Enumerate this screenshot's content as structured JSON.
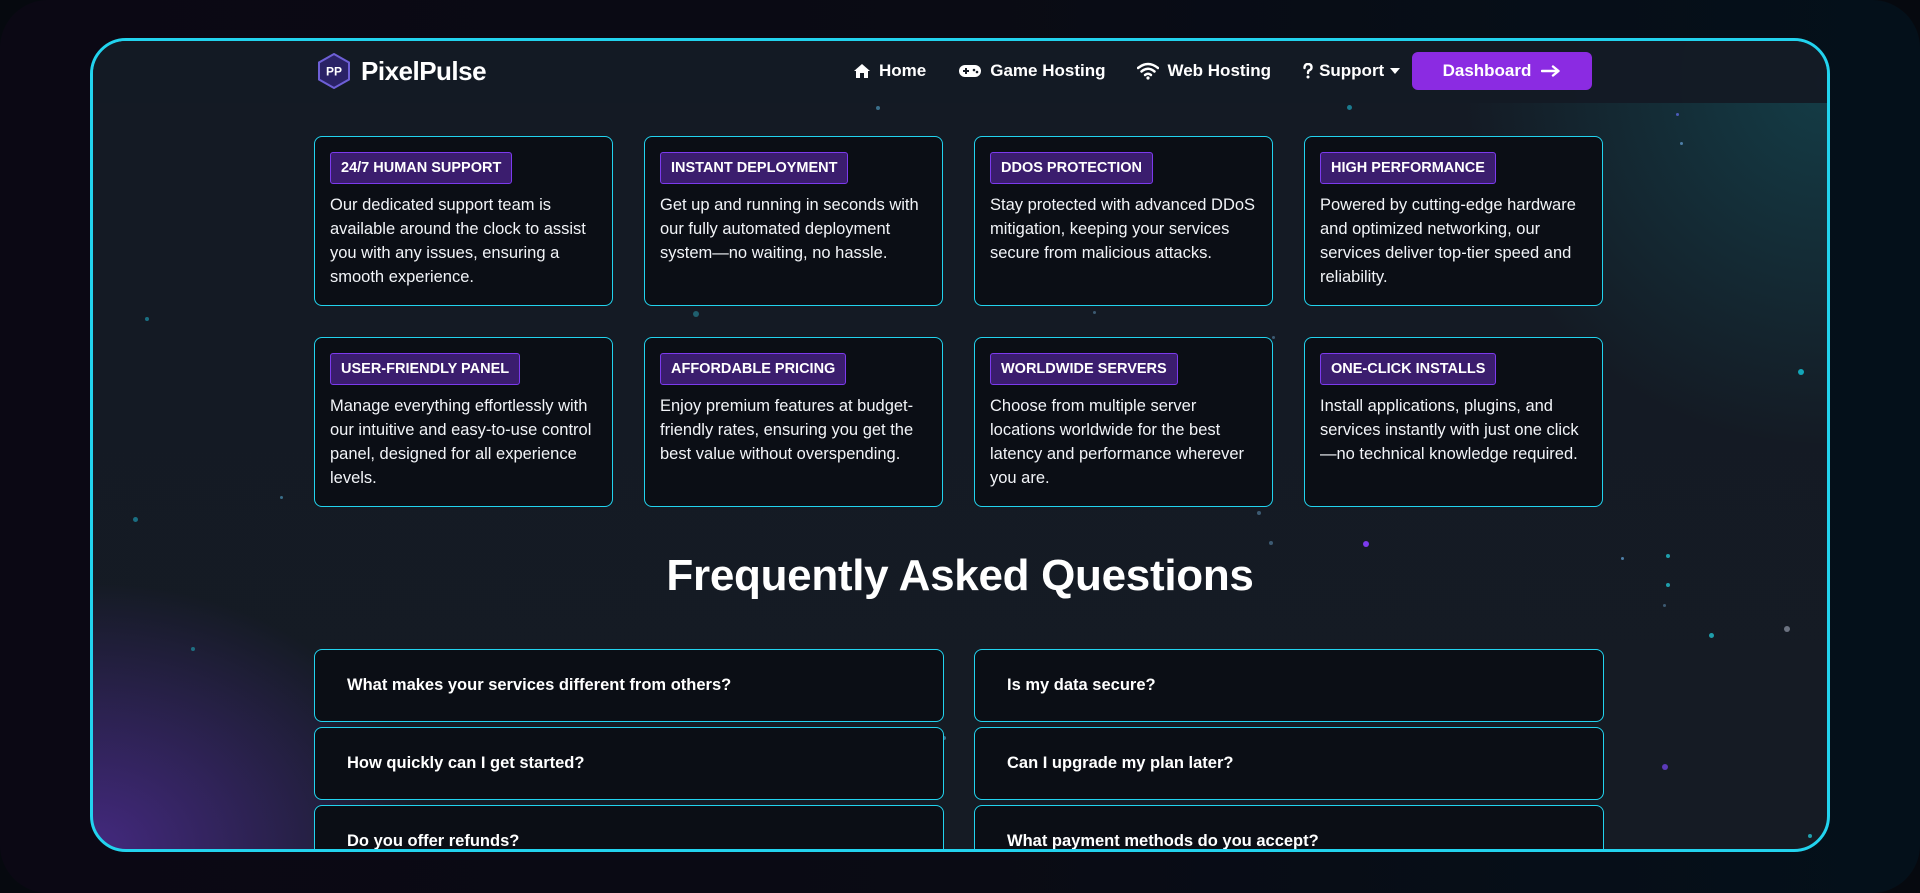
{
  "brand": {
    "logo_initials": "PP",
    "name": "PixelPulse"
  },
  "nav": {
    "links": [
      {
        "label": "Home",
        "icon": "home-icon"
      },
      {
        "label": "Game Hosting",
        "icon": "gamepad-icon"
      },
      {
        "label": "Web Hosting",
        "icon": "wifi-icon"
      },
      {
        "label": "Support",
        "icon": "question-icon"
      }
    ],
    "dashboard_label": "Dashboard"
  },
  "features": [
    {
      "badge": "24/7 Human Support",
      "text": "Our dedicated support team is available around the clock to assist you with any issues, ensuring a smooth experience."
    },
    {
      "badge": "Instant Deployment",
      "text": "Get up and running in seconds with our fully automated deployment system—no waiting, no hassle."
    },
    {
      "badge": "DDoS Protection",
      "text": "Stay protected with advanced DDoS mitigation, keeping your services secure from malicious attacks."
    },
    {
      "badge": "High Performance",
      "text": "Powered by cutting-edge hardware and optimized networking, our services deliver top-tier speed and reliability."
    },
    {
      "badge": "User-Friendly Panel",
      "text": "Manage everything effortlessly with our intuitive and easy-to-use control panel, designed for all experience levels."
    },
    {
      "badge": "Affordable Pricing",
      "text": "Enjoy premium features at budget-friendly rates, ensuring you get the best value without overspending."
    },
    {
      "badge": "Worldwide Servers",
      "text": "Choose from multiple server locations worldwide for the best latency and performance wherever you are."
    },
    {
      "badge": "One-Click Installs",
      "text": "Install applications, plugins, and services instantly with just one click—no technical knowledge required."
    }
  ],
  "faq": {
    "title": "Frequently Asked Questions",
    "left": [
      "What makes your services different from others?",
      "How quickly can I get started?",
      "Do you offer refunds?"
    ],
    "right": [
      "Is my data secure?",
      "Can I upgrade my plan later?",
      "What payment methods do you accept?"
    ]
  },
  "colors": {
    "accent_cyan": "#22d3ee",
    "accent_purple": "#8b2be2",
    "badge_bg": "#3b1d6e",
    "card_bg": "#0b0e15"
  }
}
